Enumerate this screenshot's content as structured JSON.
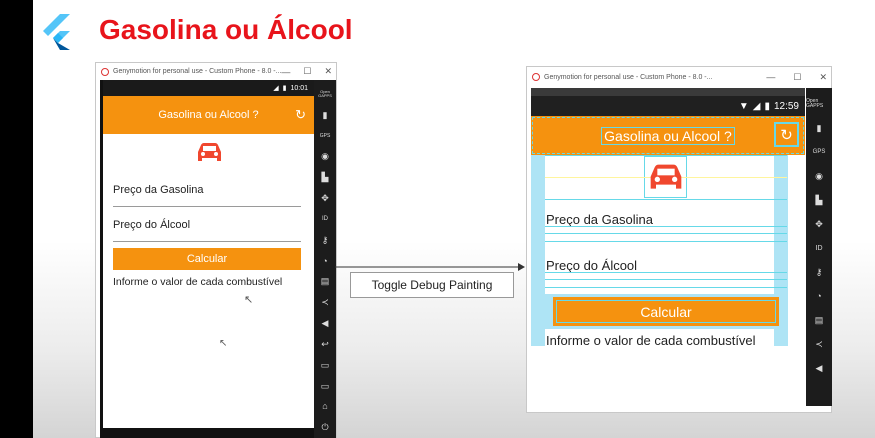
{
  "slide": {
    "title": "Gasolina ou Álcool"
  },
  "window": {
    "title": "Genymotion for personal use - Custom Phone - 8.0 -...",
    "minimize": "—",
    "maximize": "☐",
    "close": "✕"
  },
  "left_phone": {
    "time": "10:01",
    "app_title": "Gasolina ou Alcool ?",
    "gas_label": "Preço da Gasolina",
    "alc_label": "Preço do Álcool",
    "button": "Calcular",
    "info": "Informe o valor de cada combustível"
  },
  "right_phone": {
    "time": "12:59",
    "app_title": "Gasolina ou Alcool ?",
    "gas_label": "Preço da Gasolina",
    "alc_label": "Preço do Álcool",
    "button": "Calcular",
    "info": "Informe o valor de cada combustível"
  },
  "toolbar": {
    "open_gapps": "Open GAPPS",
    "gps": "GPS",
    "id": "ID"
  },
  "annotation": {
    "label": "Toggle Debug Painting"
  },
  "colors": {
    "accent": "#f5920f",
    "title_red": "#e8141b",
    "car": "#f0472e",
    "debug": "#66d9e8"
  }
}
